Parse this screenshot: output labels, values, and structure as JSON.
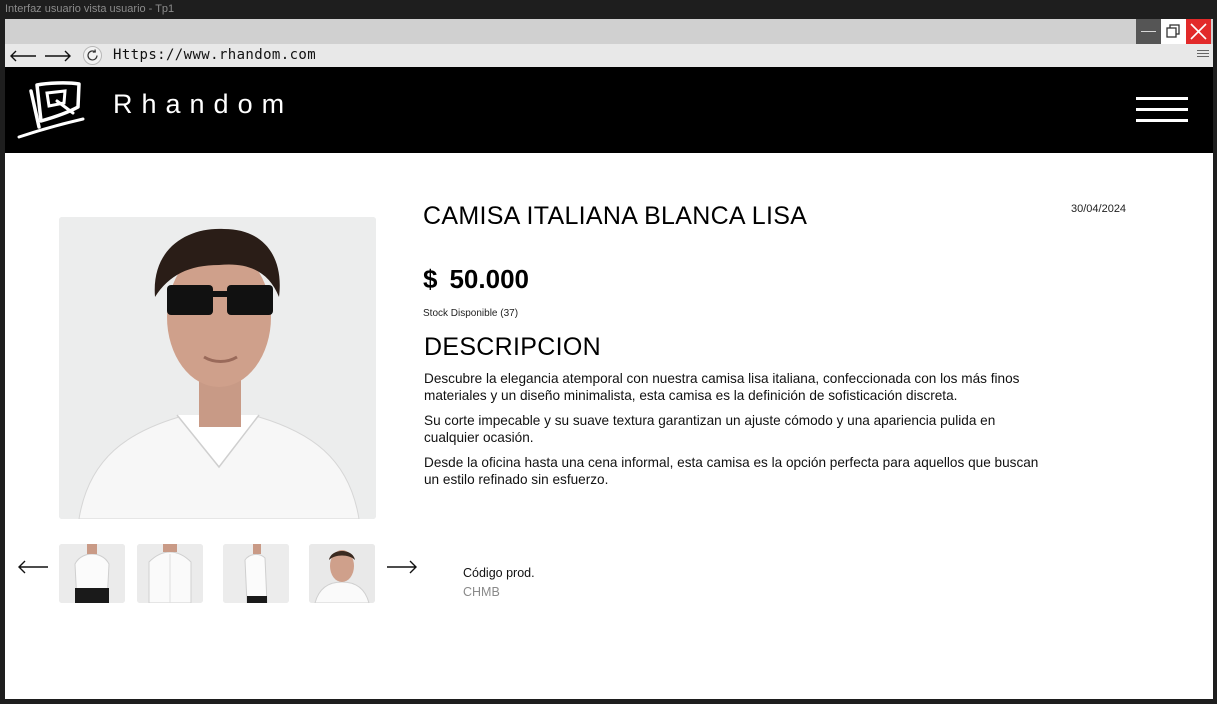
{
  "app": {
    "title": "Interfaz usuario vista usuario - Tp1"
  },
  "browser": {
    "url": "Https://www.rhandom.com",
    "back_icon": "arrow-left-icon",
    "forward_icon": "arrow-right-icon",
    "reload_icon": "reload-icon"
  },
  "site": {
    "brand": "Rhandom",
    "logo_icon": "rhandom-logo",
    "menu_icon": "hamburger-menu-icon",
    "header_color": "#000000"
  },
  "product": {
    "title": "CAMISA ITALIANA BLANCA LISA",
    "date": "30/04/2024",
    "currency": "$",
    "price": "50.000",
    "stock": "Stock Disponible (37)",
    "description_heading": "DESCRIPCION",
    "description": [
      "Descubre la elegancia atemporal con nuestra camisa lisa italiana, confeccionada con los más finos materiales y un diseño minimalista, esta camisa es la definición de sofisticación discreta.",
      "Su corte impecable y su suave textura garantizan un ajuste cómodo y una apariencia pulida en cualquier ocasión.",
      "Desde la oficina hasta una cena informal, esta camisa es la opción perfecta para aquellos que buscan un estilo refinado sin esfuerzo."
    ],
    "code_label": "Código prod.",
    "code_value": "CHMB",
    "thumbnails": [
      "front-view",
      "back-view",
      "side-view",
      "model-closeup"
    ]
  }
}
